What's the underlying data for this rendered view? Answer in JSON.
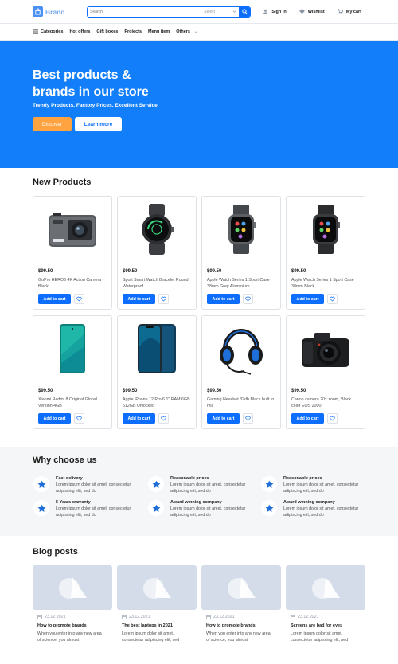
{
  "header": {
    "brand": "Brand",
    "search_placeholder": "Search",
    "search_select": "Select",
    "actions": [
      {
        "label": "Sign in",
        "icon": "user-icon"
      },
      {
        "label": "Wishlist",
        "icon": "heart-icon"
      },
      {
        "label": "My cart",
        "icon": "cart-icon"
      }
    ]
  },
  "nav": {
    "items": [
      "Categories",
      "Hot offers",
      "Gift boxes",
      "Projects",
      "Menu item",
      "Others"
    ]
  },
  "hero": {
    "title_line1": "Best products &",
    "title_line2": "brands in our store",
    "subtitle": "Trendy Products, Factory Prices, Excellent Service",
    "discover": "Discover",
    "learn_more": "Learn more"
  },
  "new_products": {
    "title": "New Products",
    "add_label": "Add to cart",
    "items": [
      {
        "price": "$99.50",
        "name": "GoPro HERO6 4K Action Camera - Black",
        "icon": "action-camera-icon"
      },
      {
        "price": "$99.50",
        "name": "Sport Smart Watch Bracelet Round Waterproof",
        "icon": "round-watch-icon"
      },
      {
        "price": "$99.50",
        "name": "Apple Watch Series 1 Sport Case 38mm Grey Aluminium",
        "icon": "smartwatch-icon"
      },
      {
        "price": "$99.50",
        "name": "Apple Watch Series 1 Sport Case 38mm Black",
        "icon": "smartwatch-icon"
      },
      {
        "price": "$99.50",
        "name": "Xiaomi Redmi 8 Original Global Version 4GB",
        "icon": "phone-teal-icon"
      },
      {
        "price": "$99.50",
        "name": "Apple iPhone 12 Pro 6.1\" RAM 6GB 512GB Unlocked",
        "icon": "iphone-icon"
      },
      {
        "price": "$99.50",
        "name": "Gaming Headset 32db Black built in mic",
        "icon": "headset-icon"
      },
      {
        "price": "$99.50",
        "name": "Canon camera 20x zoom, Black color EOS 2000",
        "icon": "dslr-camera-icon"
      }
    ]
  },
  "why": {
    "title": "Why choose us",
    "features": [
      {
        "title": "Fast delivery",
        "desc": "Lorem ipsum dolor sit amet, consectetur adipiscing elit, sed do"
      },
      {
        "title": "Reasonable prices",
        "desc": "Lorem ipsum dolor sit amet, consectetur adipiscing elit, sed do"
      },
      {
        "title": "Reasonable prices",
        "desc": "Lorem ipsum dolor sit amet, consectetur adipiscing elit, sed do"
      },
      {
        "title": "5 Years warranty",
        "desc": "Lorem ipsum dolor sit amet, consectetur adipiscing elit, sed do"
      },
      {
        "title": "Award winning company",
        "desc": "Lorem ipsum dolor sit amet, consectetur adipiscing elit, sed do"
      },
      {
        "title": "Award winning company",
        "desc": "Lorem ipsum dolor sit amet, consectetur adipiscing elit, sed do"
      }
    ]
  },
  "blog": {
    "title": "Blog posts",
    "posts": [
      {
        "date": "23.12.2021",
        "title": "How to promote brands",
        "desc": "When you enter into any new area of science, you almost"
      },
      {
        "date": "23.12.2021",
        "title": "The best laptops in 2021",
        "desc": "Lorem ipsum dolor sit amet, consectetur adipiscing elit, sed"
      },
      {
        "date": "23.12.2021",
        "title": "How to promote brands",
        "desc": "When you enter into any new area of science, you almost"
      },
      {
        "date": "23.12.2021",
        "title": "Screens are bad for eyes",
        "desc": "Lorem ipsum dolor sit amet, consectetur adipiscing elit, sed"
      }
    ]
  },
  "colors": {
    "primary": "#0d6efd",
    "hero": "#137ef9",
    "discover": "#ffa340",
    "muted": "#8b96a5"
  }
}
